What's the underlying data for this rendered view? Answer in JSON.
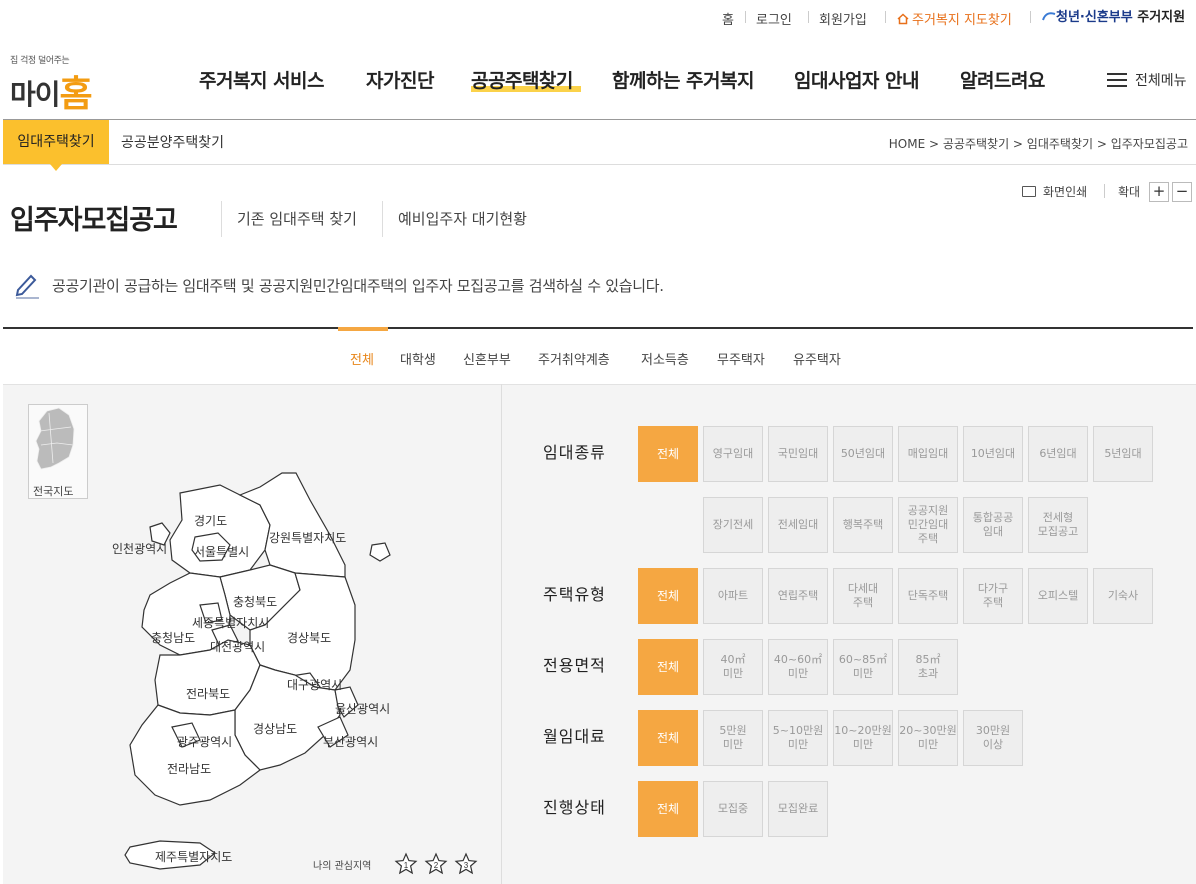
{
  "util": {
    "home": "홈",
    "login": "로그인",
    "signup": "회원가입",
    "map_link": "주거복지 지도찾기",
    "youth_blue": "청년·신혼부부",
    "youth_dark": "주거지원"
  },
  "logo": {
    "tagline": "집 걱정 덜어주는",
    "name_a": "마이",
    "name_b": "홈"
  },
  "gnb": [
    {
      "label": "주거복지 서비스"
    },
    {
      "label": "자가진단"
    },
    {
      "label": "공공주택찾기"
    },
    {
      "label": "함께하는 주거복지"
    },
    {
      "label": "임대사업자 안내"
    },
    {
      "label": "알려드려요"
    }
  ],
  "all_menu": "전체메뉴",
  "subnav": {
    "active": "임대주택찾기",
    "other": "공공분양주택찾기"
  },
  "breadcrumb": "HOME > 공공주택찾기 > 임대주택찾기 > 입주자모집공고",
  "page": {
    "title": "입주자모집공고",
    "link1": "기존 임대주택 찾기",
    "link2": "예비입주자 대기현황",
    "print": "화면인쇄",
    "zoom": "확대",
    "zoom_in": "+",
    "zoom_out": "−",
    "description": "공공기관이 공급하는 임대주택 및 공공지원민간임대주택의 입주자 모집공고를 검색하실 수 있습니다."
  },
  "categories": [
    "전체",
    "대학생",
    "신혼부부",
    "주거취약계층",
    "저소득층",
    "무주택자",
    "유주택자"
  ],
  "map": {
    "nationwide": "전국지도",
    "regions": [
      "경기도",
      "인천광역시",
      "서울특별시",
      "강원특별자치도",
      "충청북도",
      "세종특별자치시",
      "충청남도",
      "대전광역시",
      "경상북도",
      "전라북도",
      "대구광역시",
      "울산광역시",
      "경상남도",
      "광주광역시",
      "부산광역시",
      "전라남도",
      "제주특별자치도"
    ],
    "favorites_label": "나의 관심지역",
    "favorites": [
      "1",
      "2",
      "3"
    ]
  },
  "filters": {
    "rental_type": {
      "label": "임대종류",
      "options": [
        "전체",
        "영구임대",
        "국민임대",
        "50년임대",
        "매입임대",
        "10년임대",
        "6년임대",
        "5년임대",
        "장기전세",
        "전세임대",
        "행복주택",
        "공공지원\n민간임대\n주택",
        "통합공공\n임대",
        "전세형\n모집공고"
      ]
    },
    "house_type": {
      "label": "주택유형",
      "options": [
        "전체",
        "아파트",
        "연립주택",
        "다세대\n주택",
        "단독주택",
        "다가구\n주택",
        "오피스텔",
        "기숙사"
      ]
    },
    "area": {
      "label": "전용면적",
      "options": [
        "전체",
        "40㎡\n미만",
        "40~60㎡\n미만",
        "60~85㎡\n미만",
        "85㎡\n초과"
      ]
    },
    "rent": {
      "label": "월임대료",
      "options": [
        "전체",
        "5만원\n미만",
        "5~10만원\n미만",
        "10~20만원\n미만",
        "20~30만원\n미만",
        "30만원\n이상"
      ]
    },
    "status": {
      "label": "진행상태",
      "options": [
        "전체",
        "모집중",
        "모집완료"
      ]
    }
  },
  "colors": {
    "accent": "#f5a742",
    "highlight": "#fbc02d",
    "brand_orange": "#e8701a",
    "brand_blue": "#1a3a8a"
  }
}
